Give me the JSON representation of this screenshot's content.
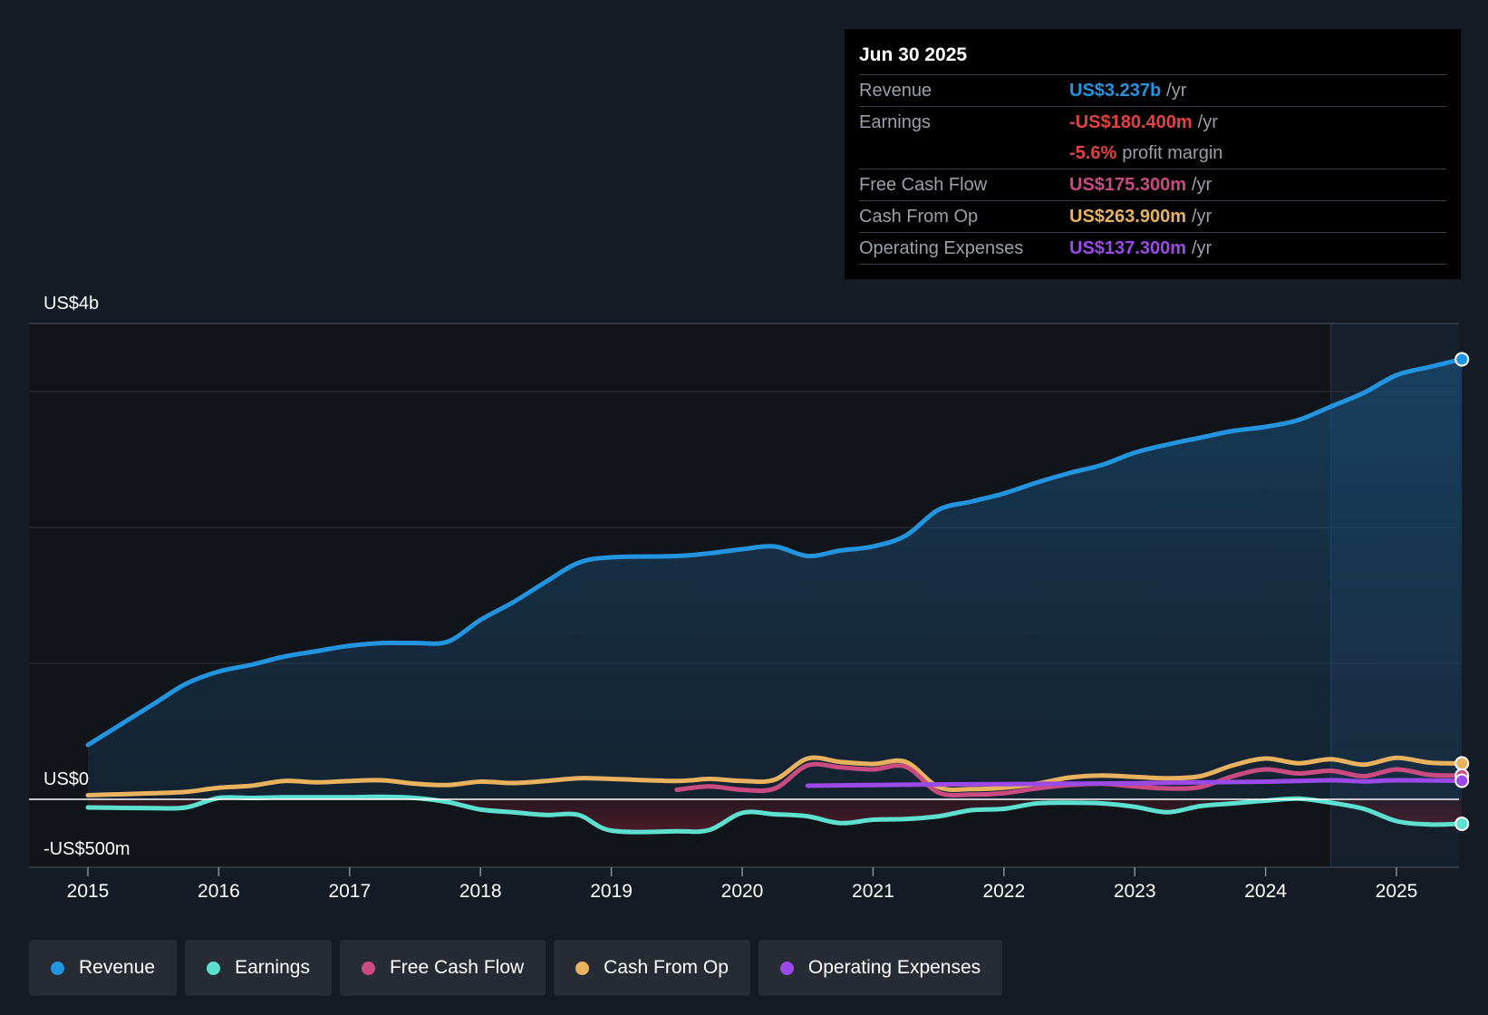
{
  "tooltip": {
    "date": "Jun 30 2025",
    "rows": [
      {
        "label": "Revenue",
        "value": "US$3.237b",
        "unit": "/yr",
        "color": "#2394df"
      },
      {
        "label": "Earnings",
        "value": "-US$180.400m",
        "unit": "/yr",
        "color": "#e64141"
      },
      {
        "label": "",
        "value": "-5.6%",
        "unit": "profit margin",
        "color": "#e64141"
      },
      {
        "label": "Free Cash Flow",
        "value": "US$175.300m",
        "unit": "/yr",
        "color": "#c94b82"
      },
      {
        "label": "Cash From Op",
        "value": "US$263.900m",
        "unit": "/yr",
        "color": "#e8b25f"
      },
      {
        "label": "Operating Expenses",
        "value": "US$137.300m",
        "unit": "/yr",
        "color": "#9b4ae8"
      }
    ]
  },
  "legend": [
    {
      "label": "Revenue",
      "color": "#2394df"
    },
    {
      "label": "Earnings",
      "color": "#5ee0cf"
    },
    {
      "label": "Free Cash Flow",
      "color": "#c94b82"
    },
    {
      "label": "Cash From Op",
      "color": "#e8b25f"
    },
    {
      "label": "Operating Expenses",
      "color": "#9b4ae8"
    }
  ],
  "chart_data": {
    "type": "line",
    "ylim": [
      -500,
      3500
    ],
    "y_tick_labels": [
      {
        "value": 3500,
        "label": "US$4b"
      },
      {
        "value": 0,
        "label": "US$0"
      },
      {
        "value": -500,
        "label": "-US$500m"
      }
    ],
    "xlim": [
      2014.55,
      2025.5
    ],
    "x_ticks": [
      2015,
      2016,
      2017,
      2018,
      2019,
      2020,
      2021,
      2022,
      2023,
      2024,
      2025
    ],
    "x_tick_labels": [
      "2015",
      "2016",
      "2017",
      "2018",
      "2019",
      "2020",
      "2021",
      "2022",
      "2023",
      "2024",
      "2025"
    ],
    "gridlines": [
      3000,
      2000,
      1000
    ],
    "highlight_from": 2024.5,
    "series": [
      {
        "name": "Revenue",
        "color": "#2394df",
        "fill": true,
        "x": [
          2015.0,
          2015.5,
          2015.75,
          2016.0,
          2016.25,
          2016.5,
          2016.75,
          2017.0,
          2017.25,
          2017.5,
          2017.75,
          2018.0,
          2018.25,
          2018.5,
          2018.75,
          2019.0,
          2019.5,
          2019.75,
          2020.0,
          2020.25,
          2020.5,
          2020.75,
          2021.0,
          2021.25,
          2021.5,
          2021.75,
          2022.0,
          2022.25,
          2022.5,
          2022.75,
          2023.0,
          2023.25,
          2023.5,
          2023.75,
          2024.0,
          2024.25,
          2024.5,
          2024.75,
          2025.0,
          2025.25,
          2025.5
        ],
        "y": [
          400,
          700,
          850,
          940,
          990,
          1050,
          1090,
          1130,
          1150,
          1150,
          1160,
          1320,
          1450,
          1600,
          1740,
          1780,
          1790,
          1810,
          1840,
          1860,
          1790,
          1830,
          1860,
          1940,
          2130,
          2190,
          2250,
          2330,
          2400,
          2460,
          2550,
          2610,
          2660,
          2710,
          2740,
          2790,
          2890,
          2990,
          3120,
          3180,
          3237
        ]
      },
      {
        "name": "Cash From Op",
        "color": "#e8b25f",
        "fill": false,
        "x": [
          2015.0,
          2015.5,
          2015.75,
          2016.0,
          2016.25,
          2016.5,
          2016.75,
          2017.0,
          2017.25,
          2017.5,
          2017.75,
          2018.0,
          2018.25,
          2018.5,
          2018.75,
          2019.0,
          2019.5,
          2019.75,
          2020.0,
          2020.25,
          2020.5,
          2020.75,
          2021.0,
          2021.25,
          2021.5,
          2021.75,
          2022.0,
          2022.25,
          2022.5,
          2022.75,
          2023.0,
          2023.25,
          2023.5,
          2023.75,
          2024.0,
          2024.25,
          2024.5,
          2024.75,
          2025.0,
          2025.25,
          2025.5
        ],
        "y": [
          30,
          45,
          55,
          85,
          100,
          135,
          125,
          135,
          140,
          115,
          105,
          130,
          120,
          135,
          155,
          150,
          135,
          150,
          135,
          145,
          300,
          275,
          260,
          275,
          90,
          75,
          85,
          115,
          160,
          175,
          165,
          155,
          170,
          250,
          300,
          265,
          295,
          255,
          305,
          270,
          264
        ]
      },
      {
        "name": "Free Cash Flow",
        "color": "#c94b82",
        "fill": false,
        "x": [
          2019.5,
          2019.75,
          2020.0,
          2020.25,
          2020.5,
          2020.75,
          2021.0,
          2021.25,
          2021.5,
          2021.75,
          2022.0,
          2022.25,
          2022.5,
          2022.75,
          2023.0,
          2023.25,
          2023.5,
          2023.75,
          2024.0,
          2024.25,
          2024.5,
          2024.75,
          2025.0,
          2025.25,
          2025.5
        ],
        "y": [
          70,
          95,
          70,
          80,
          250,
          235,
          220,
          240,
          50,
          35,
          45,
          80,
          105,
          115,
          95,
          80,
          90,
          170,
          220,
          190,
          210,
          170,
          220,
          180,
          175
        ]
      },
      {
        "name": "Operating Expenses",
        "color": "#9b4ae8",
        "fill": false,
        "x": [
          2020.5,
          2021.0,
          2021.5,
          2022.0,
          2022.5,
          2023.0,
          2023.5,
          2024.0,
          2024.5,
          2024.75,
          2025.0,
          2025.5
        ],
        "y": [
          100,
          105,
          110,
          112,
          115,
          118,
          125,
          130,
          140,
          132,
          140,
          137
        ]
      },
      {
        "name": "Earnings",
        "color": "#5ee0cf",
        "fill": true,
        "x": [
          2015.0,
          2015.5,
          2015.75,
          2016.0,
          2016.25,
          2016.5,
          2016.75,
          2017.0,
          2017.25,
          2017.5,
          2017.75,
          2018.0,
          2018.25,
          2018.5,
          2018.75,
          2019.0,
          2019.5,
          2019.75,
          2020.0,
          2020.25,
          2020.5,
          2020.75,
          2021.0,
          2021.25,
          2021.5,
          2021.75,
          2022.0,
          2022.25,
          2022.5,
          2022.75,
          2023.0,
          2023.25,
          2023.5,
          2023.75,
          2024.0,
          2024.25,
          2024.5,
          2024.75,
          2025.0,
          2025.25,
          2025.5
        ],
        "y": [
          -60,
          -65,
          -60,
          10,
          10,
          15,
          15,
          15,
          18,
          10,
          -20,
          -75,
          -95,
          -115,
          -115,
          -230,
          -235,
          -225,
          -100,
          -110,
          -125,
          -175,
          -150,
          -145,
          -125,
          -80,
          -70,
          -30,
          -25,
          -30,
          -55,
          -95,
          -50,
          -30,
          -10,
          5,
          -25,
          -70,
          -160,
          -185,
          -180
        ]
      }
    ]
  }
}
